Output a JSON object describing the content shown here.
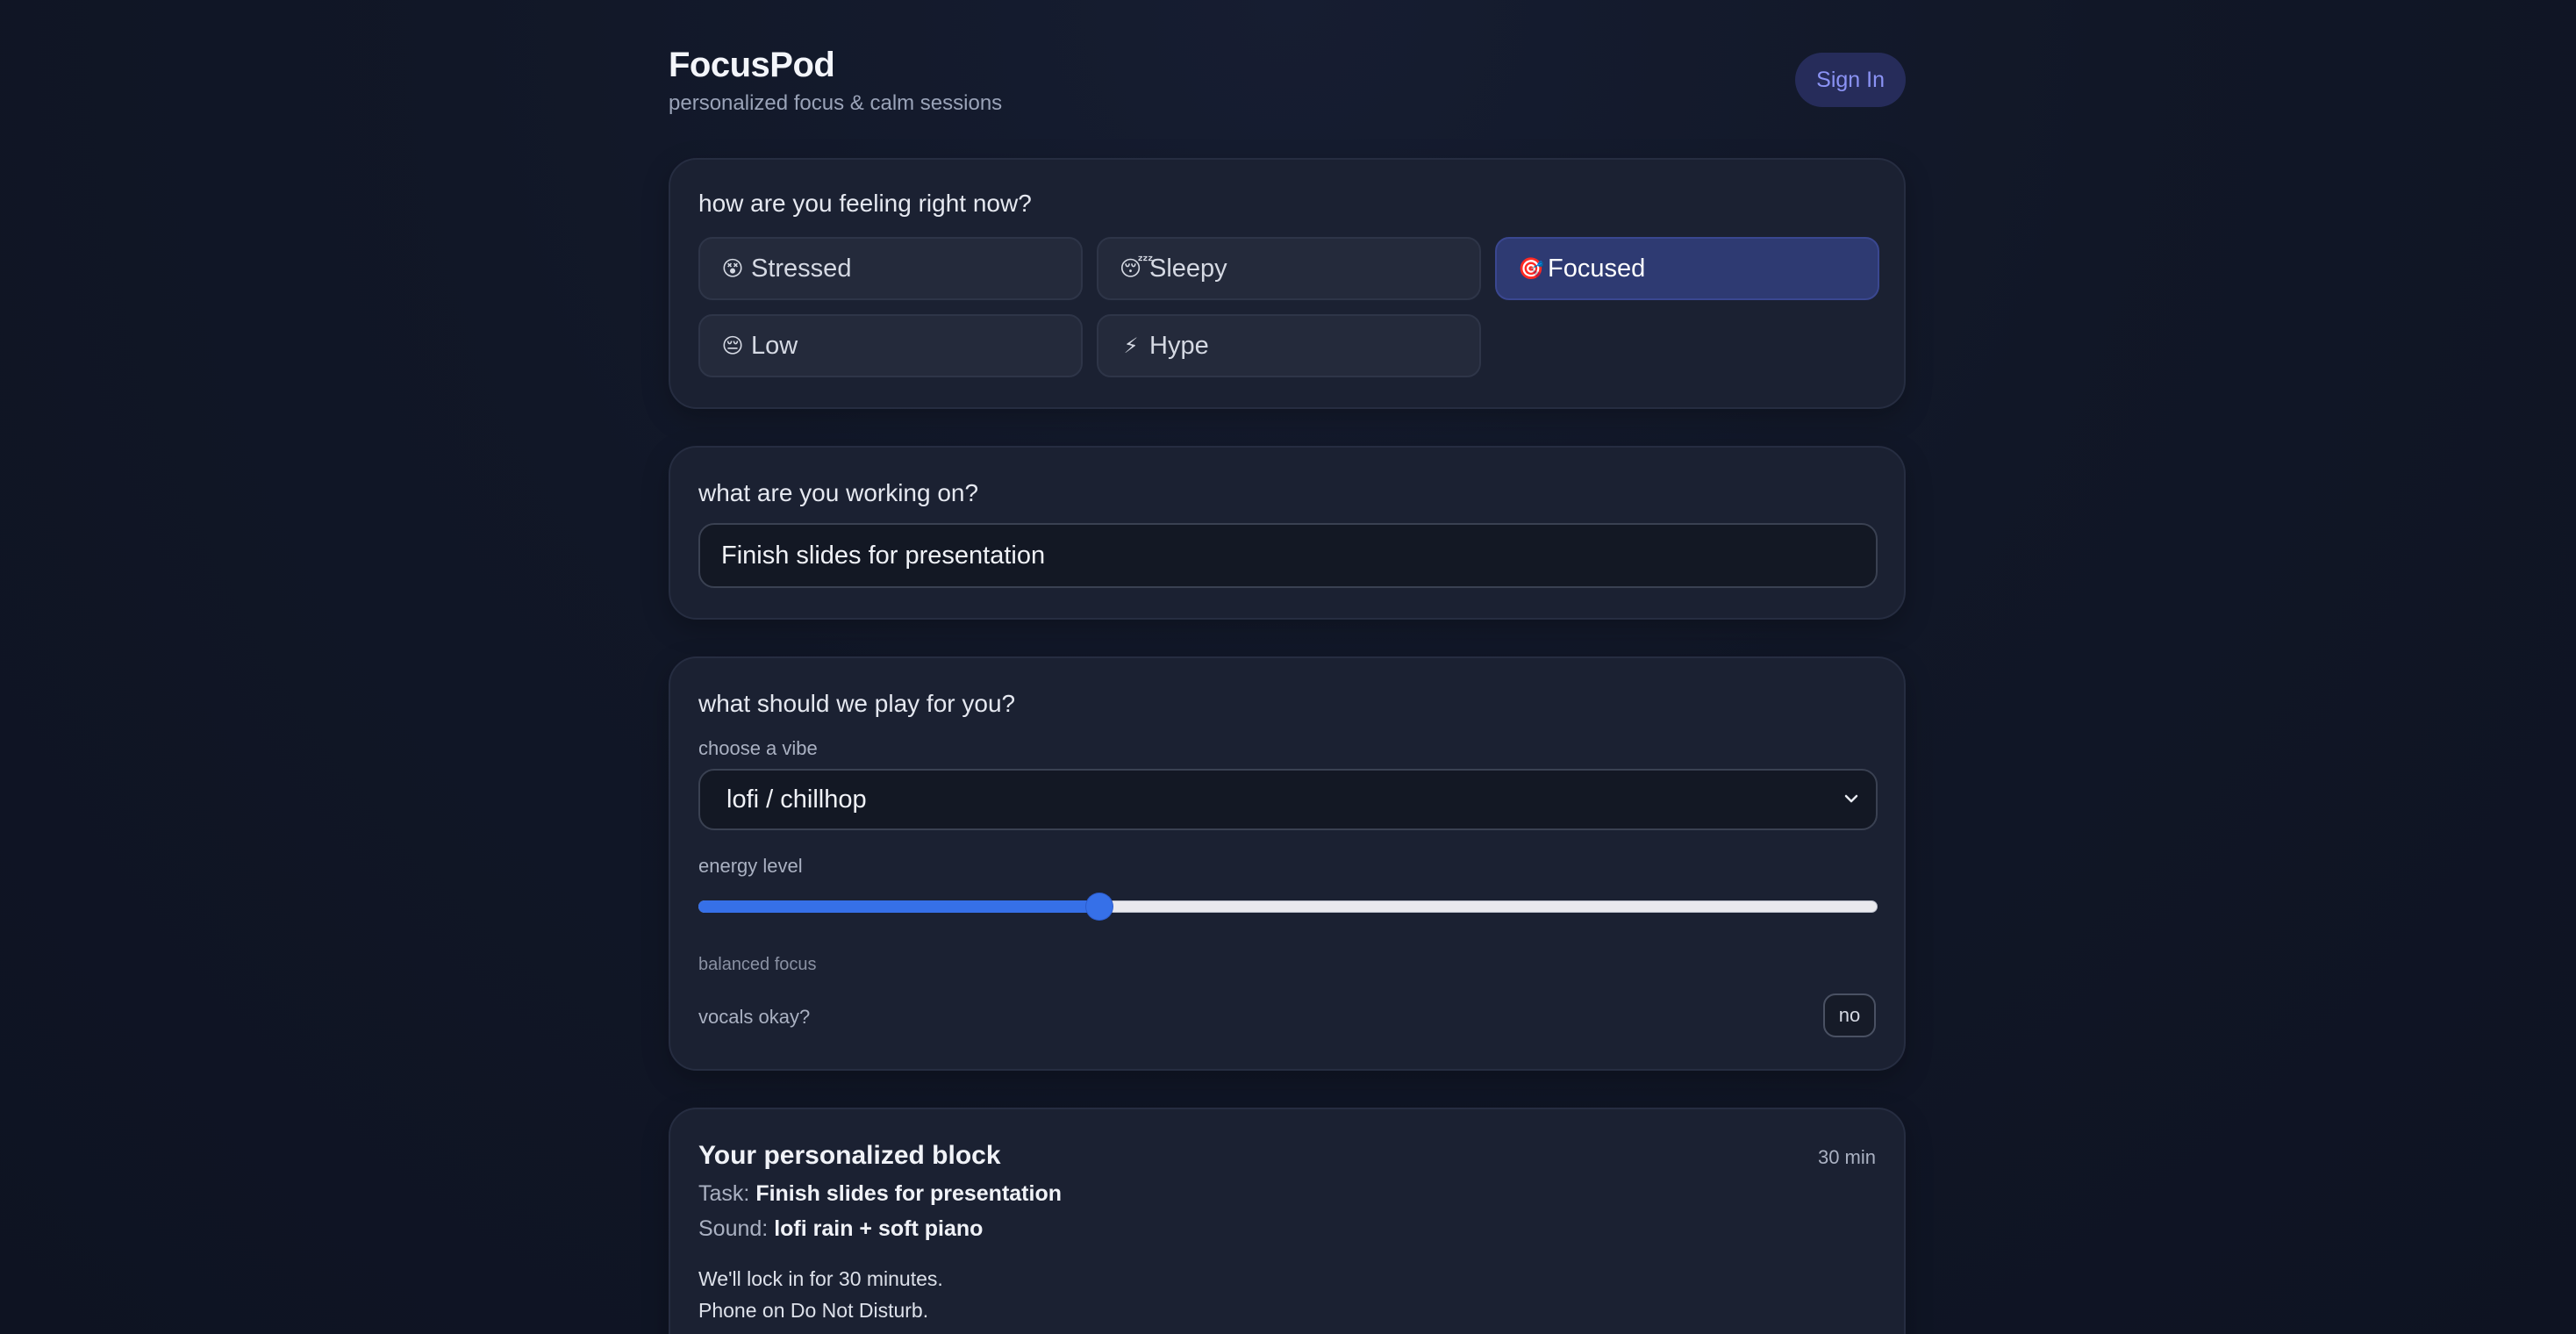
{
  "header": {
    "title": "FocusPod",
    "subtitle": "personalized focus & calm sessions",
    "sign_in_label": "Sign In"
  },
  "mood_card": {
    "question": "how are you feeling right now?",
    "options": [
      {
        "emoji": "😵",
        "label": "Stressed",
        "selected": false
      },
      {
        "emoji": "😴",
        "label": "Sleepy",
        "selected": false
      },
      {
        "emoji": "🎯",
        "label": "Focused",
        "selected": true
      },
      {
        "emoji": "😔",
        "label": "Low",
        "selected": false
      },
      {
        "emoji": "⚡",
        "label": "Hype",
        "selected": false
      }
    ]
  },
  "task_card": {
    "question": "what are you working on?",
    "task_value": "Finish slides for presentation"
  },
  "sound_card": {
    "question": "what should we play for you?",
    "vibe_label": "choose a vibe",
    "vibe_value": "lofi / chillhop",
    "energy_label": "energy level",
    "energy_fraction": 0.34,
    "energy_hint": "balanced focus",
    "vocals_label": "vocals okay?",
    "vocals_value": "no"
  },
  "summary": {
    "title": "Your personalized block",
    "duration": "30 min",
    "task_key": "Task:",
    "task_value": "Finish slides for presentation",
    "sound_key": "Sound:",
    "sound_value": "lofi rain + soft piano",
    "lines": [
      "We'll lock in for 30 minutes.",
      "Phone on Do Not Disturb."
    ]
  },
  "colors": {
    "background": "#101626",
    "card": "#1b2132",
    "accent": "#3670e8",
    "selected_mood": "#2e3a72",
    "sign_in_text": "#8b93f5"
  }
}
